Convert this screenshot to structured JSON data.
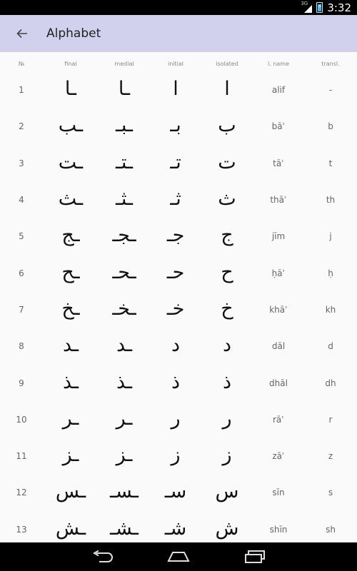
{
  "status_bar": {
    "network": "3G",
    "time": "3:32"
  },
  "app_bar": {
    "title": "Alphabet"
  },
  "table": {
    "headers": {
      "num": "№",
      "final": "final",
      "medial": "medial",
      "initial": "initial",
      "isolated": "isolated",
      "lname": "l. name",
      "translit": "transl."
    },
    "rows": [
      {
        "num": "1",
        "final": "ـا",
        "medial": "ـا",
        "initial": "ا",
        "isolated": "ا",
        "lname": "alif",
        "translit": "-"
      },
      {
        "num": "2",
        "final": "ـب",
        "medial": "ـبـ",
        "initial": "بـ",
        "isolated": "ب",
        "lname": "bāʾ",
        "translit": "b"
      },
      {
        "num": "3",
        "final": "ـت",
        "medial": "ـتـ",
        "initial": "تـ",
        "isolated": "ت",
        "lname": "tāʾ",
        "translit": "t"
      },
      {
        "num": "4",
        "final": "ـث",
        "medial": "ـثـ",
        "initial": "ثـ",
        "isolated": "ث",
        "lname": "thāʾ",
        "translit": "th"
      },
      {
        "num": "5",
        "final": "ـج",
        "medial": "ـجـ",
        "initial": "جـ",
        "isolated": "ج",
        "lname": "jīm",
        "translit": "j"
      },
      {
        "num": "6",
        "final": "ـح",
        "medial": "ـحـ",
        "initial": "حـ",
        "isolated": "ح",
        "lname": "ḥāʾ",
        "translit": "ḥ"
      },
      {
        "num": "7",
        "final": "ـخ",
        "medial": "ـخـ",
        "initial": "خـ",
        "isolated": "خ",
        "lname": "khāʾ",
        "translit": "kh"
      },
      {
        "num": "8",
        "final": "ـد",
        "medial": "ـد",
        "initial": "د",
        "isolated": "د",
        "lname": "dāl",
        "translit": "d"
      },
      {
        "num": "9",
        "final": "ـذ",
        "medial": "ـذ",
        "initial": "ذ",
        "isolated": "ذ",
        "lname": "dhāl",
        "translit": "dh"
      },
      {
        "num": "10",
        "final": "ـر",
        "medial": "ـر",
        "initial": "ر",
        "isolated": "ر",
        "lname": "rāʾ",
        "translit": "r"
      },
      {
        "num": "11",
        "final": "ـز",
        "medial": "ـز",
        "initial": "ز",
        "isolated": "ز",
        "lname": "zāʾ",
        "translit": "z"
      },
      {
        "num": "12",
        "final": "ـس",
        "medial": "ـسـ",
        "initial": "سـ",
        "isolated": "س",
        "lname": "sīn",
        "translit": "s"
      },
      {
        "num": "13",
        "final": "ـش",
        "medial": "ـشـ",
        "initial": "شـ",
        "isolated": "ش",
        "lname": "shīn",
        "translit": "sh"
      }
    ]
  },
  "nav_bar": {
    "buttons": [
      "back-icon",
      "home-icon",
      "recents-icon"
    ]
  },
  "colors": {
    "app_bar": "#d1d1ee",
    "background": "#fafafa",
    "battery": "#33b5e5"
  }
}
